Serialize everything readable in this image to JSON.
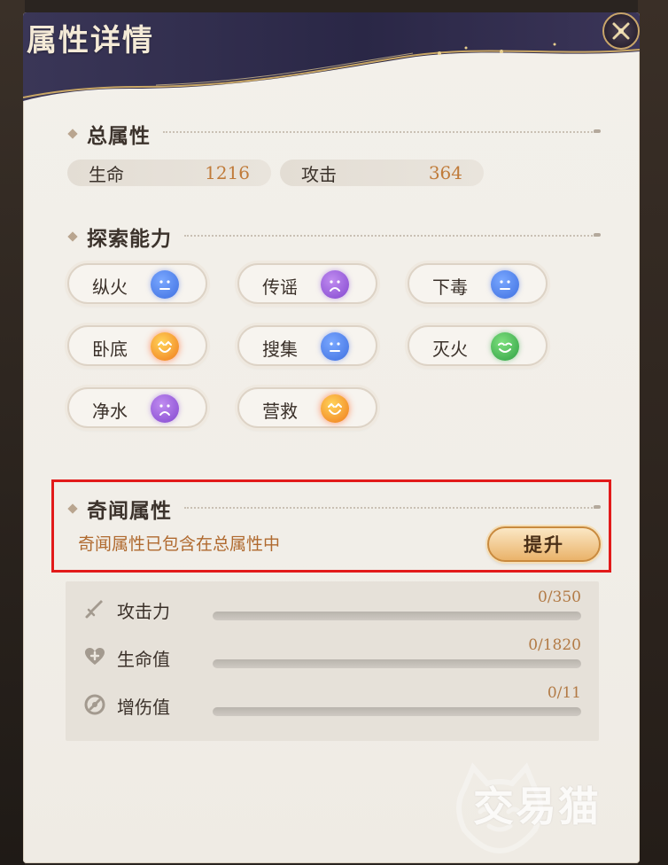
{
  "window": {
    "title": "属性详情"
  },
  "total_attributes": {
    "heading": "总属性",
    "stats": [
      {
        "label": "生命",
        "value": "1216"
      },
      {
        "label": "攻击",
        "value": "364"
      }
    ]
  },
  "exploration": {
    "heading": "探索能力",
    "abilities": [
      {
        "label": "纵火",
        "mood": "neutral",
        "icon": "neutral-face-icon",
        "color": "#4a7ae6"
      },
      {
        "label": "传谣",
        "mood": "sad",
        "icon": "sad-face-icon",
        "color": "#8a4fd4"
      },
      {
        "label": "下毒",
        "mood": "neutral",
        "icon": "neutral-face-icon",
        "color": "#4a7ae6"
      },
      {
        "label": "卧底",
        "mood": "happy",
        "icon": "happy-face-icon",
        "color": "#f07a1c"
      },
      {
        "label": "搜集",
        "mood": "neutral",
        "icon": "neutral-face-icon",
        "color": "#4a7ae6"
      },
      {
        "label": "灭火",
        "mood": "smile",
        "icon": "smile-face-icon",
        "color": "#2fa043"
      },
      {
        "label": "净水",
        "mood": "sad",
        "icon": "sad-face-icon",
        "color": "#8a4fd4"
      },
      {
        "label": "营救",
        "mood": "happy",
        "icon": "happy-face-icon",
        "color": "#f07a1c"
      }
    ]
  },
  "rumor_attributes": {
    "heading": "奇闻属性",
    "description": "奇闻属性已包含在总属性中",
    "upgrade_label": "提升"
  },
  "bonus_stats": [
    {
      "label": "攻击力",
      "value": "0/350",
      "icon": "sword-icon",
      "progress": 0
    },
    {
      "label": "生命值",
      "value": "0/1820",
      "icon": "heart-plus-icon",
      "progress": 0
    },
    {
      "label": "增伤值",
      "value": "0/11",
      "icon": "damage-boost-icon",
      "progress": 0
    }
  ],
  "watermark": {
    "text": "交易猫"
  },
  "colors": {
    "accent": "#c07b3a",
    "highlight_border": "#e21a1a",
    "header_dark": "#2c2947",
    "gold": "#c8a56a"
  }
}
